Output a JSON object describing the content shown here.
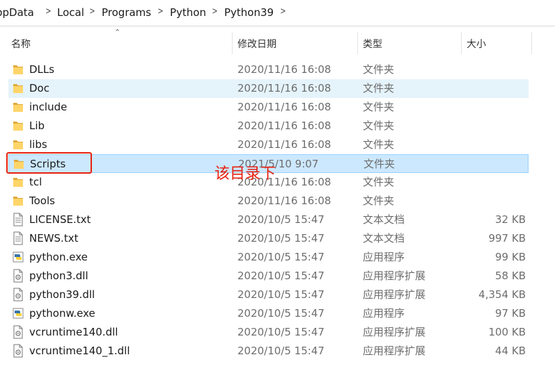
{
  "breadcrumb": [
    "ppData",
    "Local",
    "Programs",
    "Python",
    "Python39"
  ],
  "columns": {
    "name": "名称",
    "date": "修改日期",
    "type": "类型",
    "size": "大小"
  },
  "rows": [
    {
      "name": "DLLs",
      "date": "2020/11/16 16:08",
      "type": "文件夹",
      "size": "",
      "icon": "folder-icon"
    },
    {
      "name": "Doc",
      "date": "2020/11/16 16:08",
      "type": "文件夹",
      "size": "",
      "icon": "folder-icon"
    },
    {
      "name": "include",
      "date": "2020/11/16 16:08",
      "type": "文件夹",
      "size": "",
      "icon": "folder-icon"
    },
    {
      "name": "Lib",
      "date": "2020/11/16 16:08",
      "type": "文件夹",
      "size": "",
      "icon": "folder-icon"
    },
    {
      "name": "libs",
      "date": "2020/11/16 16:08",
      "type": "文件夹",
      "size": "",
      "icon": "folder-icon"
    },
    {
      "name": "Scripts",
      "date": "2021/5/10 9:07",
      "type": "文件夹",
      "size": "",
      "icon": "folder-icon"
    },
    {
      "name": "tcl",
      "date": "2020/11/16 16:08",
      "type": "文件夹",
      "size": "",
      "icon": "folder-icon"
    },
    {
      "name": "Tools",
      "date": "2020/11/16 16:08",
      "type": "文件夹",
      "size": "",
      "icon": "folder-icon"
    },
    {
      "name": "LICENSE.txt",
      "date": "2020/10/5 15:47",
      "type": "文本文档",
      "size": "32 KB",
      "icon": "text-file-icon"
    },
    {
      "name": "NEWS.txt",
      "date": "2020/10/5 15:47",
      "type": "文本文档",
      "size": "997 KB",
      "icon": "text-file-icon"
    },
    {
      "name": "python.exe",
      "date": "2020/10/5 15:47",
      "type": "应用程序",
      "size": "99 KB",
      "icon": "python-app-icon"
    },
    {
      "name": "python3.dll",
      "date": "2020/10/5 15:47",
      "type": "应用程序扩展",
      "size": "58 KB",
      "icon": "dll-file-icon"
    },
    {
      "name": "python39.dll",
      "date": "2020/10/5 15:47",
      "type": "应用程序扩展",
      "size": "4,354 KB",
      "icon": "dll-file-icon"
    },
    {
      "name": "pythonw.exe",
      "date": "2020/10/5 15:47",
      "type": "应用程序",
      "size": "97 KB",
      "icon": "python-app-icon"
    },
    {
      "name": "vcruntime140.dll",
      "date": "2020/10/5 15:47",
      "type": "应用程序扩展",
      "size": "100 KB",
      "icon": "dll-file-icon"
    },
    {
      "name": "vcruntime140_1.dll",
      "date": "2020/10/5 15:47",
      "type": "应用程序扩展",
      "size": "44 KB",
      "icon": "dll-file-icon"
    }
  ],
  "hover_row": "Doc",
  "selected_row": "Scripts",
  "annotation": {
    "text": "该目录下",
    "color": "#e8210f"
  }
}
